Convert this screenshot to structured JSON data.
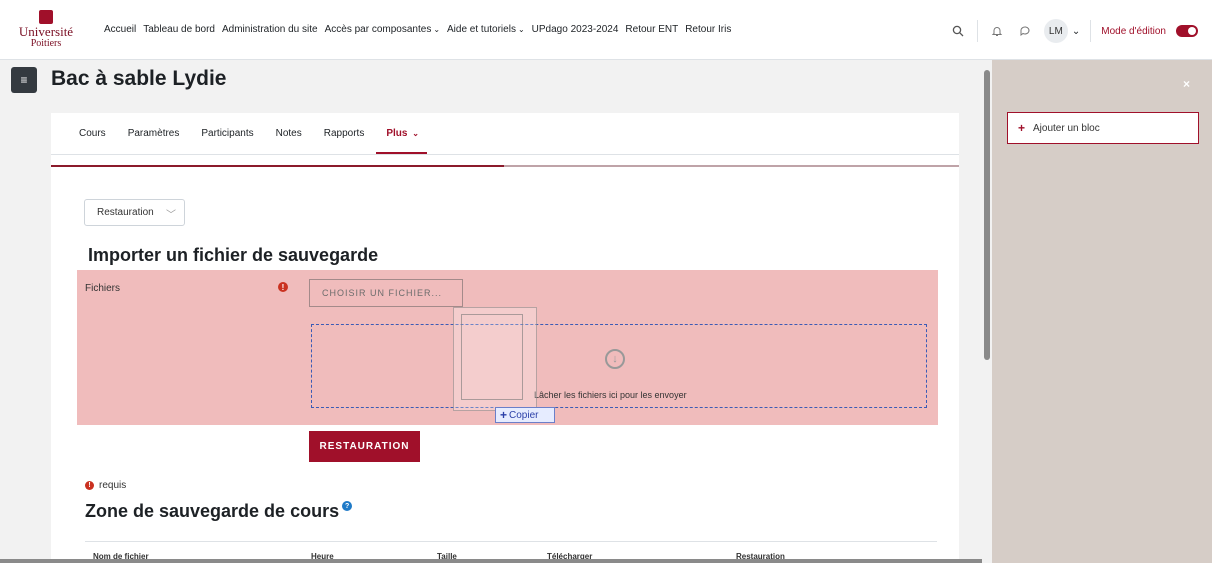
{
  "logo": {
    "line1": "Université",
    "line2": "Poitiers"
  },
  "topnav": [
    {
      "label": "Accueil",
      "dropdown": false
    },
    {
      "label": "Tableau de bord",
      "dropdown": false
    },
    {
      "label": "Administration du site",
      "dropdown": false
    },
    {
      "label": "Accès par composantes",
      "dropdown": true
    },
    {
      "label": "Aide et tutoriels",
      "dropdown": true
    },
    {
      "label": "UPdago 2023-2024",
      "dropdown": false
    },
    {
      "label": "Retour ENT",
      "dropdown": false
    },
    {
      "label": "Retour Iris",
      "dropdown": false
    }
  ],
  "user": {
    "initials": "LM"
  },
  "edit_mode": {
    "label": "Mode d'édition",
    "on": true
  },
  "page": {
    "title": "Bac à sable Lydie"
  },
  "secnav": [
    {
      "label": "Cours"
    },
    {
      "label": "Paramètres"
    },
    {
      "label": "Participants"
    },
    {
      "label": "Notes"
    },
    {
      "label": "Rapports"
    },
    {
      "label": "Plus",
      "active": true
    }
  ],
  "restore_select": {
    "value": "Restauration"
  },
  "import": {
    "heading": "Importer un fichier de sauvegarde",
    "files_label": "Fichiers",
    "choose_button": "CHOISIR UN FICHIER...",
    "drop_text": "Lâcher les fichiers ici pour les envoyer",
    "copy_tooltip": "Copier",
    "submit_button": "RESTAURATION"
  },
  "required_note": "requis",
  "backup_zone": {
    "heading": "Zone de sauvegarde de cours",
    "columns": [
      "Nom de fichier",
      "Heure",
      "Taille",
      "Télécharger",
      "Restauration"
    ]
  },
  "right_drawer": {
    "add_block": "Ajouter un bloc"
  },
  "colors": {
    "brand": "#a0102a",
    "error_bg": "#f0bcbc",
    "drawer_bg": "#d6cdc7"
  }
}
